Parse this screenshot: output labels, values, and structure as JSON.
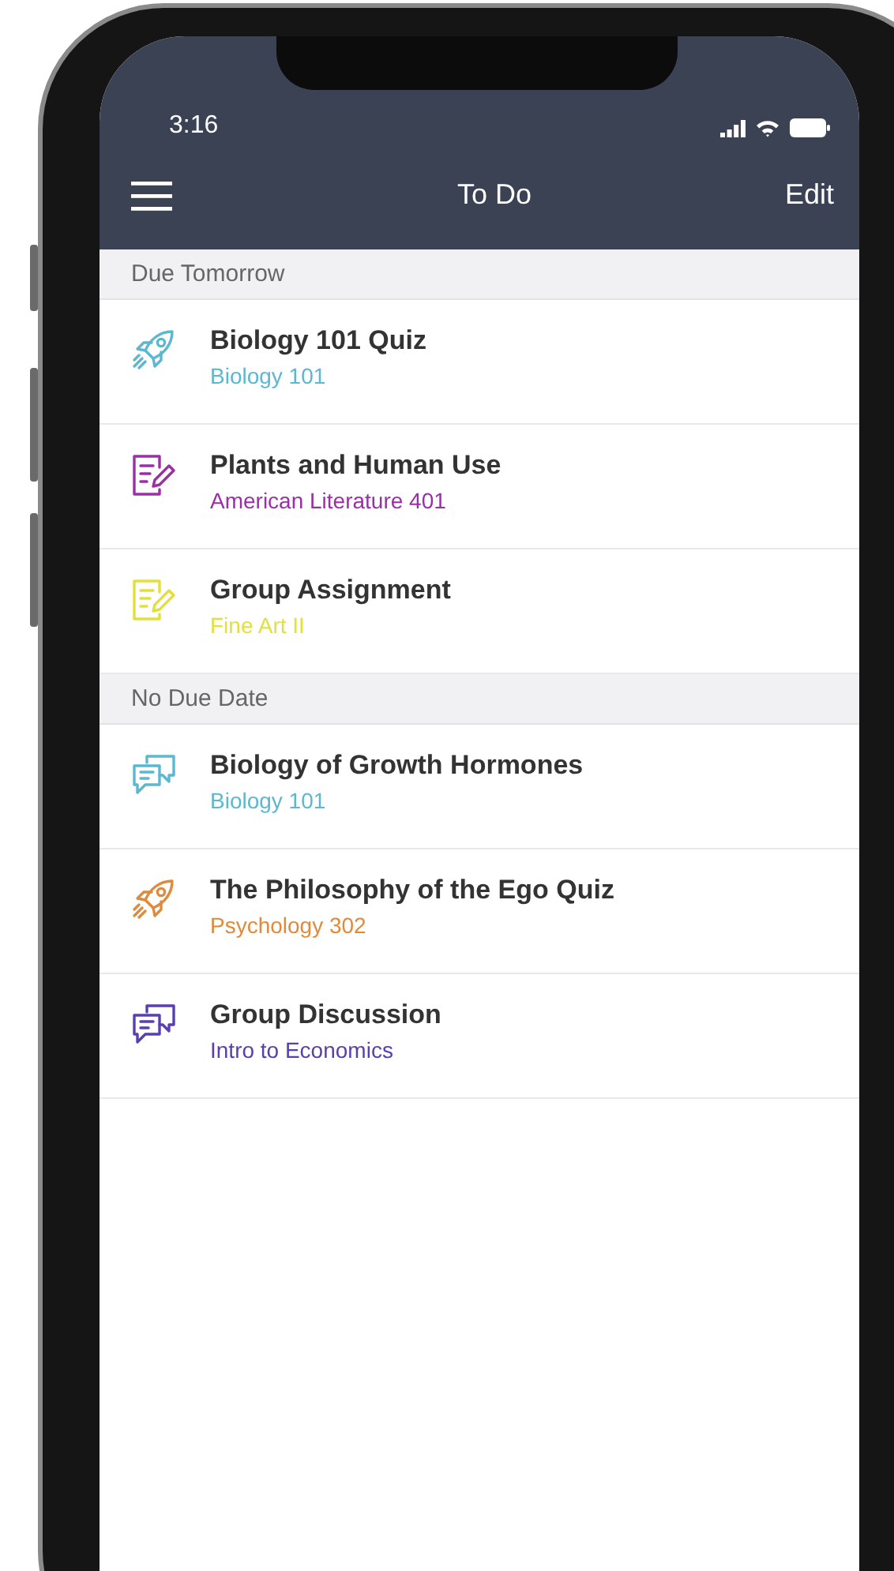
{
  "status_bar": {
    "time": "3:16"
  },
  "nav_bar": {
    "title": "To Do",
    "action": "Edit"
  },
  "sections": [
    {
      "title": "Due Tomorrow",
      "items": [
        {
          "kind": "quiz",
          "title": "Biology 101 Quiz",
          "course": "Biology 101",
          "color": "#5bb8d0"
        },
        {
          "kind": "assignment",
          "title": "Plants and Human Use",
          "course": "American Literature 401",
          "color": "#9b2fa8"
        },
        {
          "kind": "assignment",
          "title": "Group Assignment",
          "course": "Fine Art II",
          "color": "#e3e03a"
        }
      ]
    },
    {
      "title": "No Due Date",
      "items": [
        {
          "kind": "discussion",
          "title": "Biology of Growth Hormones",
          "course": "Biology 101",
          "color": "#5bb8d0"
        },
        {
          "kind": "quiz",
          "title": "The Philosophy of the Ego Quiz",
          "course": "Psychology 302",
          "color": "#e08a3c"
        },
        {
          "kind": "discussion",
          "title": "Group Discussion",
          "course": "Intro to Economics",
          "color": "#5a3fb0"
        }
      ]
    }
  ]
}
